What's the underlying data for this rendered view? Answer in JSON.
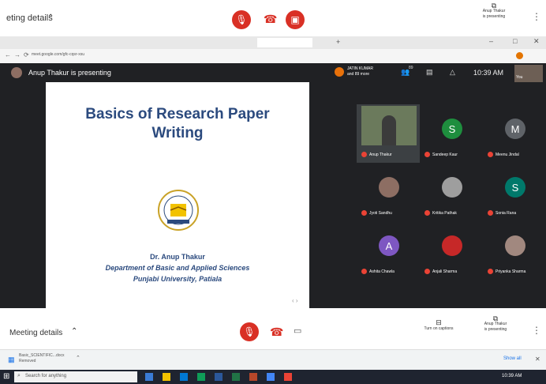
{
  "outer": {
    "meeting_details": "eting details",
    "presenter_status_line1": "Anup Thakur",
    "presenter_status_line2": "is presenting"
  },
  "browser": {
    "url": "meet.google.com/gfc-cqsr-xsu"
  },
  "meet": {
    "presenting_text": "Anup Thakur is presenting",
    "participants_badge_line1": "JATIN KUMAR",
    "participants_badge_line2": "and 89 more",
    "participant_count": "89",
    "time": "10:39 AM",
    "host_label": "You"
  },
  "slide": {
    "title_line1": "Basics of Research Paper",
    "title_line2": "Writing",
    "author": "Dr. Anup Thakur",
    "dept": "Department of Basic and Applied Sciences",
    "univ": "Punjabi University, Patiala"
  },
  "tiles": [
    {
      "name": "Anup Thakur",
      "avatar": "",
      "type": "video"
    },
    {
      "name": "Sandeep Kaur",
      "avatar": "S",
      "color": "#1e8e3e"
    },
    {
      "name": "Meenu Jindal",
      "avatar": "M",
      "color": "#5f6368"
    },
    {
      "name": "Jyoti Sandhu",
      "avatar": "",
      "color": "#8d6e63"
    },
    {
      "name": "Kritika Pathak",
      "avatar": "",
      "color": "#9e9e9e"
    },
    {
      "name": "Sonia Rana",
      "avatar": "S",
      "color": "#00796b"
    },
    {
      "name": "Ashita Chawla",
      "avatar": "A",
      "color": "#7e57c2"
    },
    {
      "name": "Anjali Sharma",
      "avatar": "",
      "color": "#c62828"
    },
    {
      "name": "Priyanka Sharma",
      "avatar": "",
      "color": "#a1887f"
    }
  ],
  "bottom": {
    "meeting_details": "Meeting details",
    "captions": "Turn on captions",
    "presenter_line1": "Anup Thakur",
    "presenter_line2": "is presenting"
  },
  "download": {
    "file": "Basic_SCIENTIFIC...docx",
    "status": "Removed",
    "show_all": "Show all"
  },
  "taskbar": {
    "search": "Search for anything",
    "time": "10:39 AM"
  },
  "colors": {
    "red": "#d93025",
    "meet_bg": "#202124",
    "slide_text": "#2b4a7e"
  }
}
